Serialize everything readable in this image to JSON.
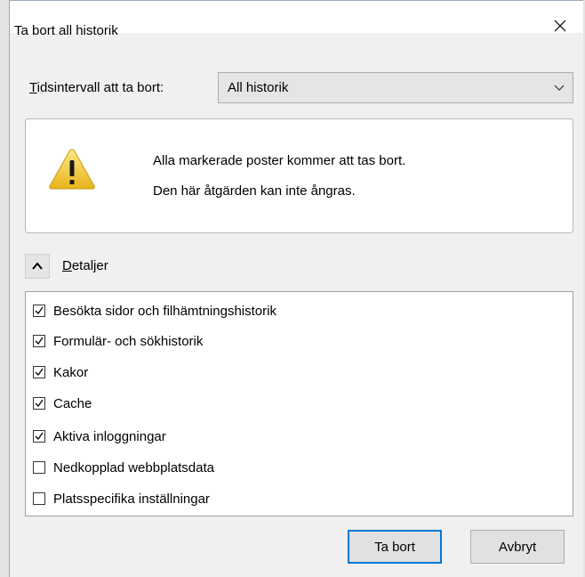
{
  "dialog": {
    "title": "Ta bort all historik"
  },
  "time_range": {
    "label_accel": "T",
    "label_rest": "idsintervall att ta bort:",
    "selected": "All historik"
  },
  "warning": {
    "line1": "Alla markerade poster kommer att tas bort.",
    "line2": "Den här åtgärden kan inte ångras."
  },
  "details": {
    "label_accel": "D",
    "label_rest": "etaljer",
    "expanded": true
  },
  "items": [
    {
      "label": "Besökta sidor och filhämtningshistorik",
      "checked": true
    },
    {
      "label": "Formulär- och sökhistorik",
      "checked": true
    },
    {
      "label": "Kakor",
      "checked": true
    },
    {
      "label": "Cache",
      "checked": true
    },
    {
      "label": "Aktiva inloggningar",
      "checked": true
    },
    {
      "label": "Nedkopplad webbplatsdata",
      "checked": false
    },
    {
      "label": "Platsspecifika inställningar",
      "checked": false
    }
  ],
  "buttons": {
    "ok": "Ta bort",
    "cancel": "Avbryt"
  }
}
